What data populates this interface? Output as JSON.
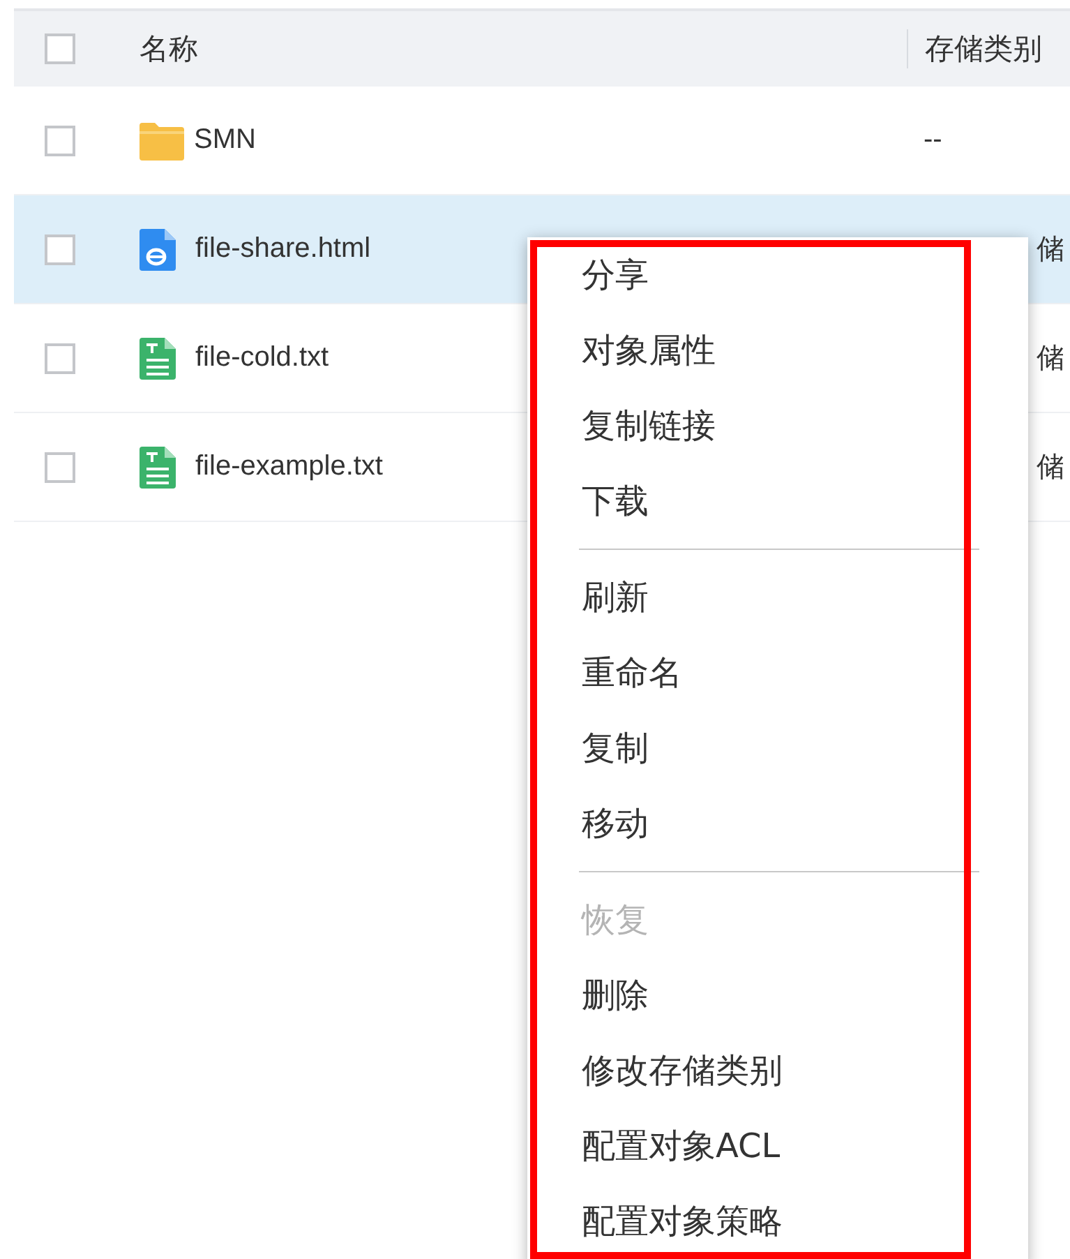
{
  "table": {
    "columns": [
      {
        "label": "名称"
      },
      {
        "label": "存储类别"
      }
    ],
    "header_checkbox": {
      "checked": false
    },
    "rows": [
      {
        "kind": "folder",
        "name": "SMN",
        "storage": "--",
        "selected": false,
        "checked": false
      },
      {
        "kind": "html",
        "name": "file-share.html",
        "storage": "储",
        "storage_covered": true,
        "selected": true,
        "checked": false
      },
      {
        "kind": "txt",
        "name": "file-cold.txt",
        "storage": "储",
        "storage_covered": true,
        "selected": false,
        "checked": false
      },
      {
        "kind": "txt",
        "name": "file-example.txt",
        "storage": "储",
        "storage_covered": true,
        "selected": false,
        "checked": false
      }
    ]
  },
  "context_menu": {
    "highlighted": true,
    "sections": [
      [
        {
          "label": "分享",
          "disabled": false
        },
        {
          "label": "对象属性",
          "disabled": false
        },
        {
          "label": "复制链接",
          "disabled": false
        },
        {
          "label": "下载",
          "disabled": false
        }
      ],
      [
        {
          "label": "刷新",
          "disabled": false
        },
        {
          "label": "重命名",
          "disabled": false
        },
        {
          "label": "复制",
          "disabled": false
        },
        {
          "label": "移动",
          "disabled": false
        }
      ],
      [
        {
          "label": "恢复",
          "disabled": true
        },
        {
          "label": "删除",
          "disabled": false
        },
        {
          "label": "修改存储类别",
          "disabled": false
        },
        {
          "label": "配置对象ACL",
          "disabled": false
        },
        {
          "label": "配置对象策略",
          "disabled": false
        }
      ]
    ]
  }
}
